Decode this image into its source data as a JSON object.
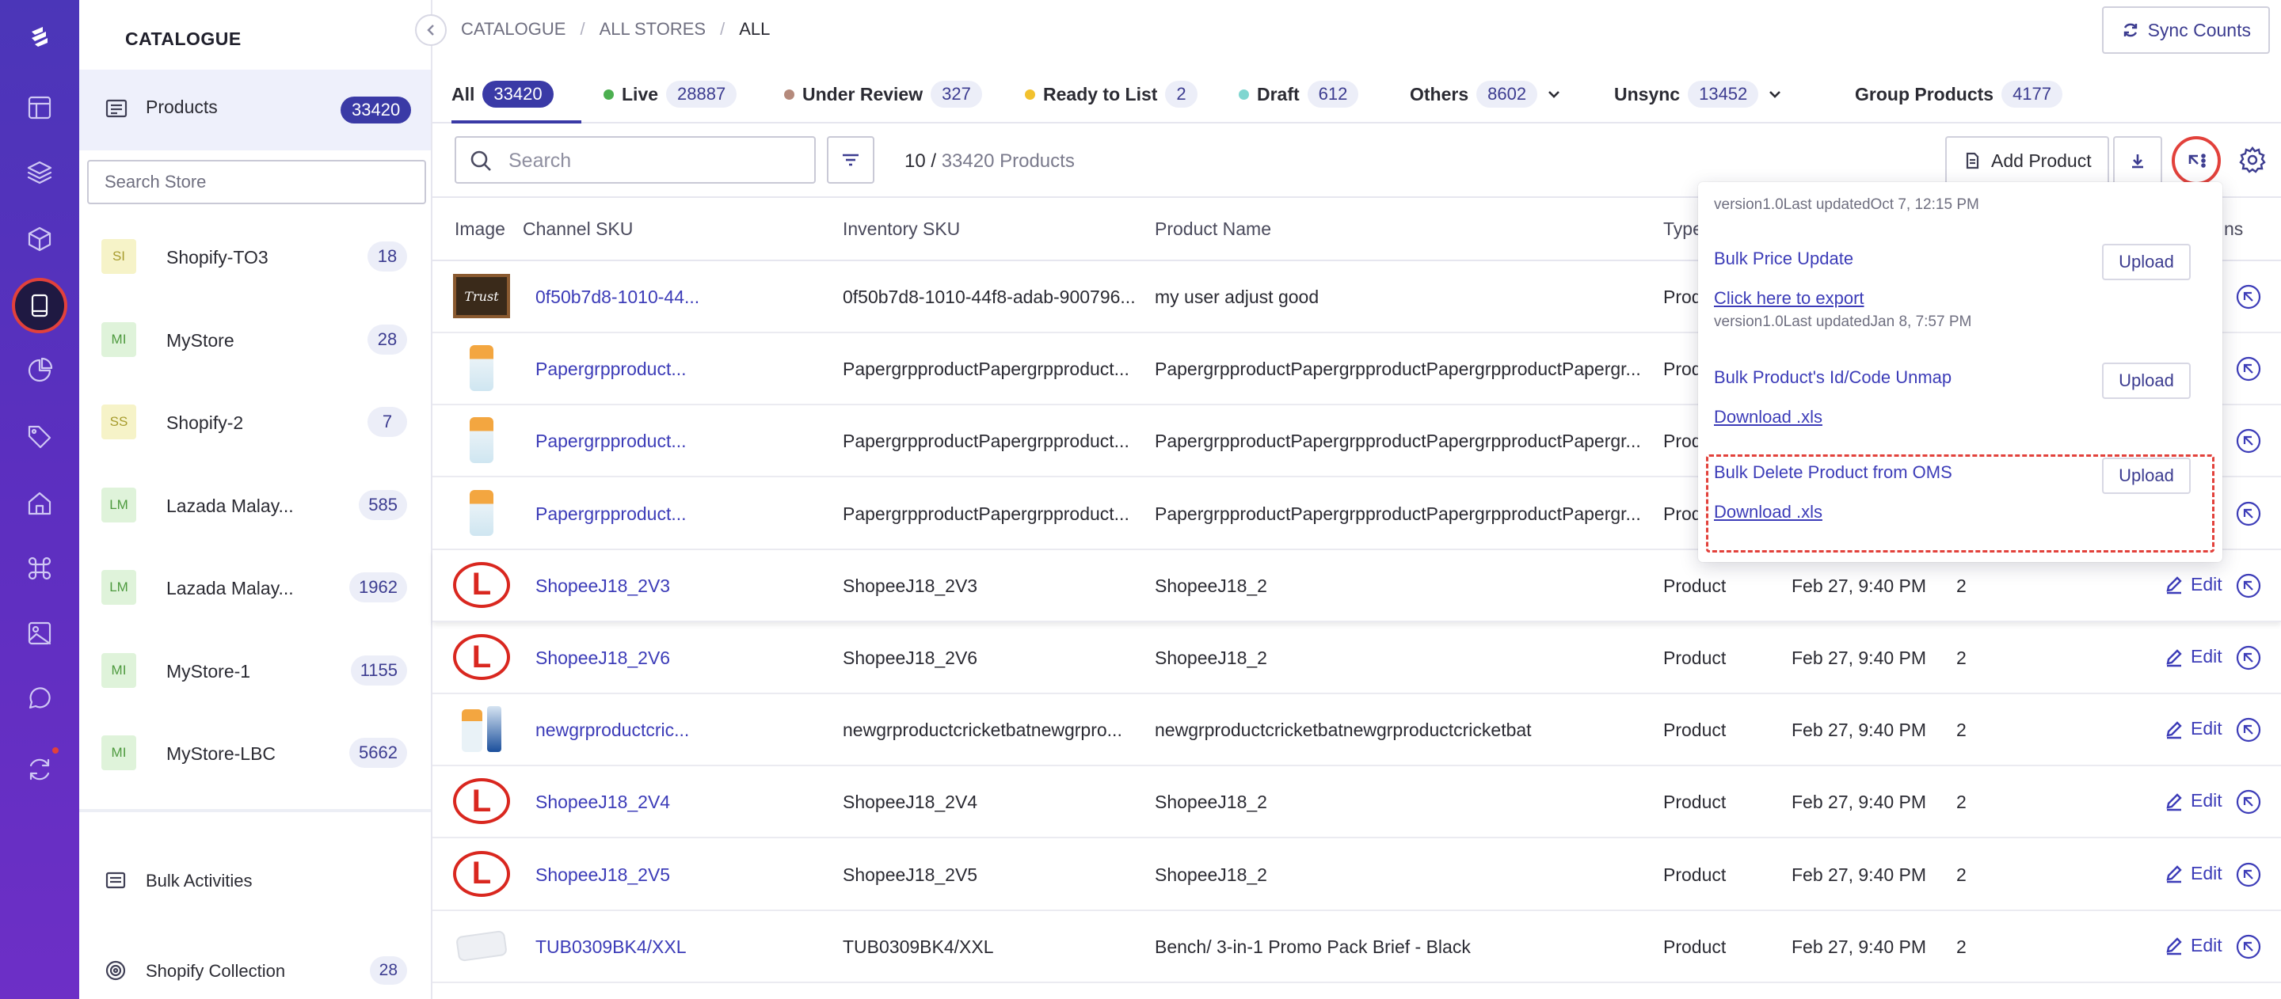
{
  "rail": {
    "icons": [
      "logo-icon",
      "layout-icon",
      "layers-icon",
      "cube-icon",
      "tablet-icon",
      "chart-pie-icon",
      "tag-icon",
      "home-icon",
      "command-icon",
      "image-icon",
      "chat-icon",
      "sync-icon"
    ],
    "active_icon": "tablet-icon",
    "notification_color": "#e2413b"
  },
  "sidebar": {
    "title": "CATALOGUE",
    "products": {
      "label": "Products",
      "count": "33420"
    },
    "search_placeholder": "Search Store",
    "stores": [
      {
        "abbr": "SI",
        "name": "Shopify-TO3",
        "count": "18",
        "bg": "#f6f3c8",
        "fg": "#a79c2e"
      },
      {
        "abbr": "MI",
        "name": "MyStore",
        "count": "28",
        "bg": "#dff3da",
        "fg": "#4e9a3f"
      },
      {
        "abbr": "SS",
        "name": "Shopify-2",
        "count": "7",
        "bg": "#f6f3c8",
        "fg": "#a79c2e"
      },
      {
        "abbr": "LM",
        "name": "Lazada Malay...",
        "count": "585",
        "bg": "#dff3da",
        "fg": "#4e9a3f"
      },
      {
        "abbr": "LM",
        "name": "Lazada Malay...",
        "count": "1962",
        "bg": "#dff3da",
        "fg": "#4e9a3f"
      },
      {
        "abbr": "MI",
        "name": "MyStore-1",
        "count": "1155",
        "bg": "#dff3da",
        "fg": "#4e9a3f"
      },
      {
        "abbr": "MI",
        "name": "MyStore-LBC",
        "count": "5662",
        "bg": "#dff3da",
        "fg": "#4e9a3f"
      }
    ],
    "bulk_activities": "Bulk Activities",
    "shopify_collection": {
      "label": "Shopify Collection",
      "count": "28"
    }
  },
  "breadcrumb": {
    "items": [
      "CATALOGUE",
      "ALL STORES",
      "ALL"
    ],
    "sep": "/"
  },
  "sync_counts": "Sync Counts",
  "tabs": [
    {
      "label": "All",
      "count": "33420",
      "dot": ""
    },
    {
      "label": "Live",
      "count": "28887",
      "dot": "#4caf50"
    },
    {
      "label": "Under Review",
      "count": "327",
      "dot": "#b58a7c"
    },
    {
      "label": "Ready to List",
      "count": "2",
      "dot": "#f2c12e"
    },
    {
      "label": "Draft",
      "count": "612",
      "dot": "#7fd6d0"
    },
    {
      "label": "Others",
      "count": "8602",
      "dot": ""
    },
    {
      "label": "Unsync",
      "count": "13452",
      "dot": ""
    },
    {
      "label": "Group Products",
      "count": "4177",
      "dot": ""
    }
  ],
  "toolbar": {
    "search_placeholder": "Search",
    "count_current": "10 /",
    "count_total": "33420 Products",
    "add_product": "Add Product"
  },
  "table": {
    "headers": {
      "image": "Image",
      "channel_sku": "Channel SKU",
      "inventory_sku": "Inventory SKU",
      "product_name": "Product Name",
      "type": "Type",
      "actions": "ns"
    },
    "edit_label": "Edit",
    "rows": [
      {
        "thumb": "chalkboard",
        "channel_sku": "0f50b7d8-1010-44...",
        "inventory_sku": "0f50b7d8-1010-44f8-adab-900796...",
        "name": "my user adjust good",
        "type": "Prod",
        "date": "",
        "qty": ""
      },
      {
        "thumb": "bottle",
        "channel_sku": "Papergrpproduct...",
        "inventory_sku": "PapergrpproductPapergrpproduct...",
        "name": "PapergrpproductPapergrpproductPapergrpproductPapergr...",
        "type": "Prod",
        "date": "",
        "qty": ""
      },
      {
        "thumb": "bottle",
        "channel_sku": "Papergrpproduct...",
        "inventory_sku": "PapergrpproductPapergrpproduct...",
        "name": "PapergrpproductPapergrpproductPapergrpproductPapergr...",
        "type": "Prod",
        "date": "",
        "qty": ""
      },
      {
        "thumb": "bottle",
        "channel_sku": "Papergrpproduct...",
        "inventory_sku": "PapergrpproductPapergrpproduct...",
        "name": "PapergrpproductPapergrpproductPapergrpproductPapergr...",
        "type": "Prod",
        "date": "",
        "qty": ""
      },
      {
        "thumb": "logo",
        "channel_sku": "ShopeeJ18_2V3",
        "inventory_sku": "ShopeeJ18_2V3",
        "name": "ShopeeJ18_2",
        "type": "Product",
        "date": "Feb 27, 9:40 PM",
        "qty": "2"
      },
      {
        "thumb": "logo",
        "channel_sku": "ShopeeJ18_2V6",
        "inventory_sku": "ShopeeJ18_2V6",
        "name": "ShopeeJ18_2",
        "type": "Product",
        "date": "Feb 27, 9:40 PM",
        "qty": "2"
      },
      {
        "thumb": "bottle2",
        "channel_sku": "newgrproductcric...",
        "inventory_sku": "newgrproductcricketbatnewgrpro...",
        "name": "newgrproductcricketbatnewgrproductcricketbat",
        "type": "Product",
        "date": "Feb 27, 9:40 PM",
        "qty": "2"
      },
      {
        "thumb": "logo",
        "channel_sku": "ShopeeJ18_2V4",
        "inventory_sku": "ShopeeJ18_2V4",
        "name": "ShopeeJ18_2",
        "type": "Product",
        "date": "Feb 27, 9:40 PM",
        "qty": "2"
      },
      {
        "thumb": "logo",
        "channel_sku": "ShopeeJ18_2V5",
        "inventory_sku": "ShopeeJ18_2V5",
        "name": "ShopeeJ18_2",
        "type": "Product",
        "date": "Feb 27, 9:40 PM",
        "qty": "2"
      },
      {
        "thumb": "plain",
        "channel_sku": "TUB0309BK4/XXL",
        "inventory_sku": "TUB0309BK4/XXL",
        "name": "Bench/ 3-in-1 Promo Pack Brief - Black",
        "type": "Product",
        "date": "Feb 27, 9:40 PM",
        "qty": "2"
      }
    ]
  },
  "dropdown": {
    "meta_top": "version1.0Last updatedOct 7, 12:15 PM",
    "sections": [
      {
        "title": "Bulk Price Update",
        "link": "Click here to export",
        "meta": "version1.0Last updatedJan 8, 7:57 PM",
        "button": "Upload"
      },
      {
        "title": "Bulk Product's Id/Code Unmap",
        "link": "Download .xls",
        "meta": "",
        "button": "Upload"
      },
      {
        "title": "Bulk Delete Product from OMS",
        "link": "Download .xls",
        "meta": "",
        "button": "Upload"
      }
    ],
    "highlight_color": "#e2413b"
  }
}
